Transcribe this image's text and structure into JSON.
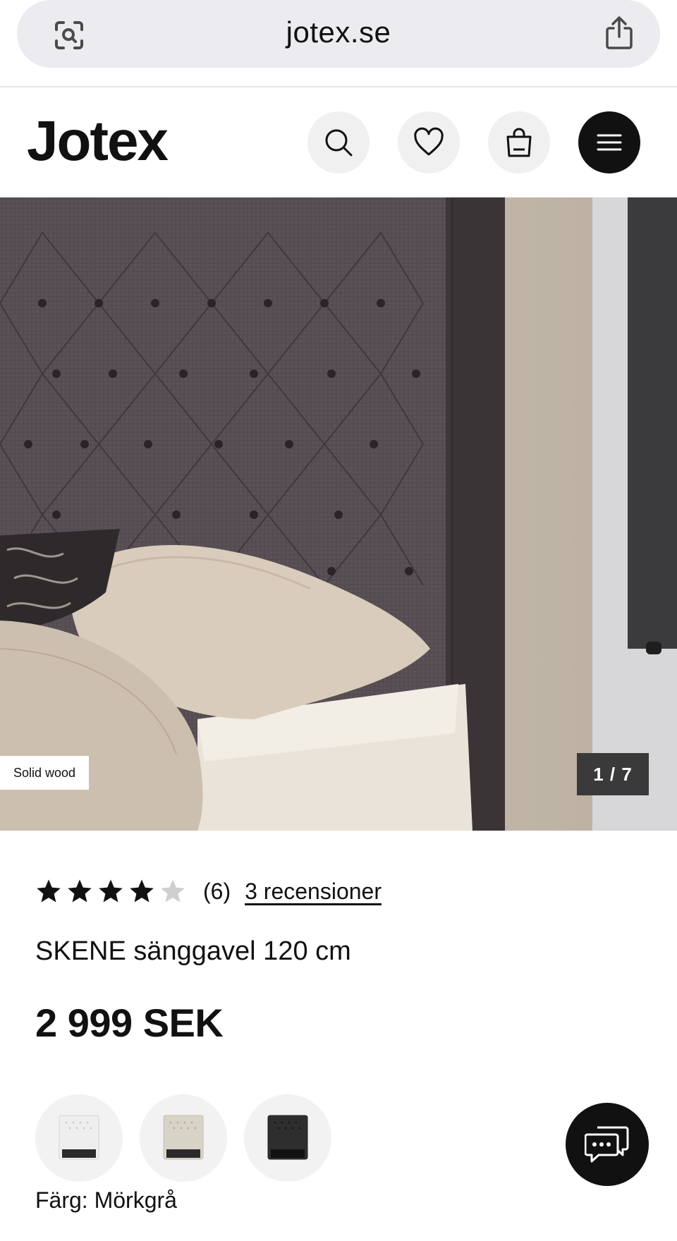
{
  "browser": {
    "url": "jotex.se",
    "icons": {
      "lens": "visual-lookup-icon",
      "share": "share-icon"
    }
  },
  "header": {
    "logo": "Jotex",
    "icons": [
      "search-icon",
      "heart-icon",
      "shopping-bag-icon",
      "menu-icon"
    ]
  },
  "gallery": {
    "badge": "Solid wood",
    "counter": "1 / 7",
    "current_index": 1,
    "total": 7
  },
  "product": {
    "rating": {
      "stars": 4,
      "max": 5,
      "count": "(6)",
      "reviews_link": "3 recensioner"
    },
    "title": "SKENE sänggavel 120 cm",
    "price": "2 999 SEK",
    "color_label": "Färg: Mörkgrå",
    "swatches": [
      {
        "name": "white",
        "color": "#eeeeee"
      },
      {
        "name": "beige",
        "color": "#d8d3c7"
      },
      {
        "name": "dark-grey",
        "color": "#2e2e2e"
      }
    ]
  },
  "colors": {
    "header_menu_bg": "#111111",
    "url_bar_bg": "#ececf0",
    "counter_bg": "#3a3a3a"
  }
}
